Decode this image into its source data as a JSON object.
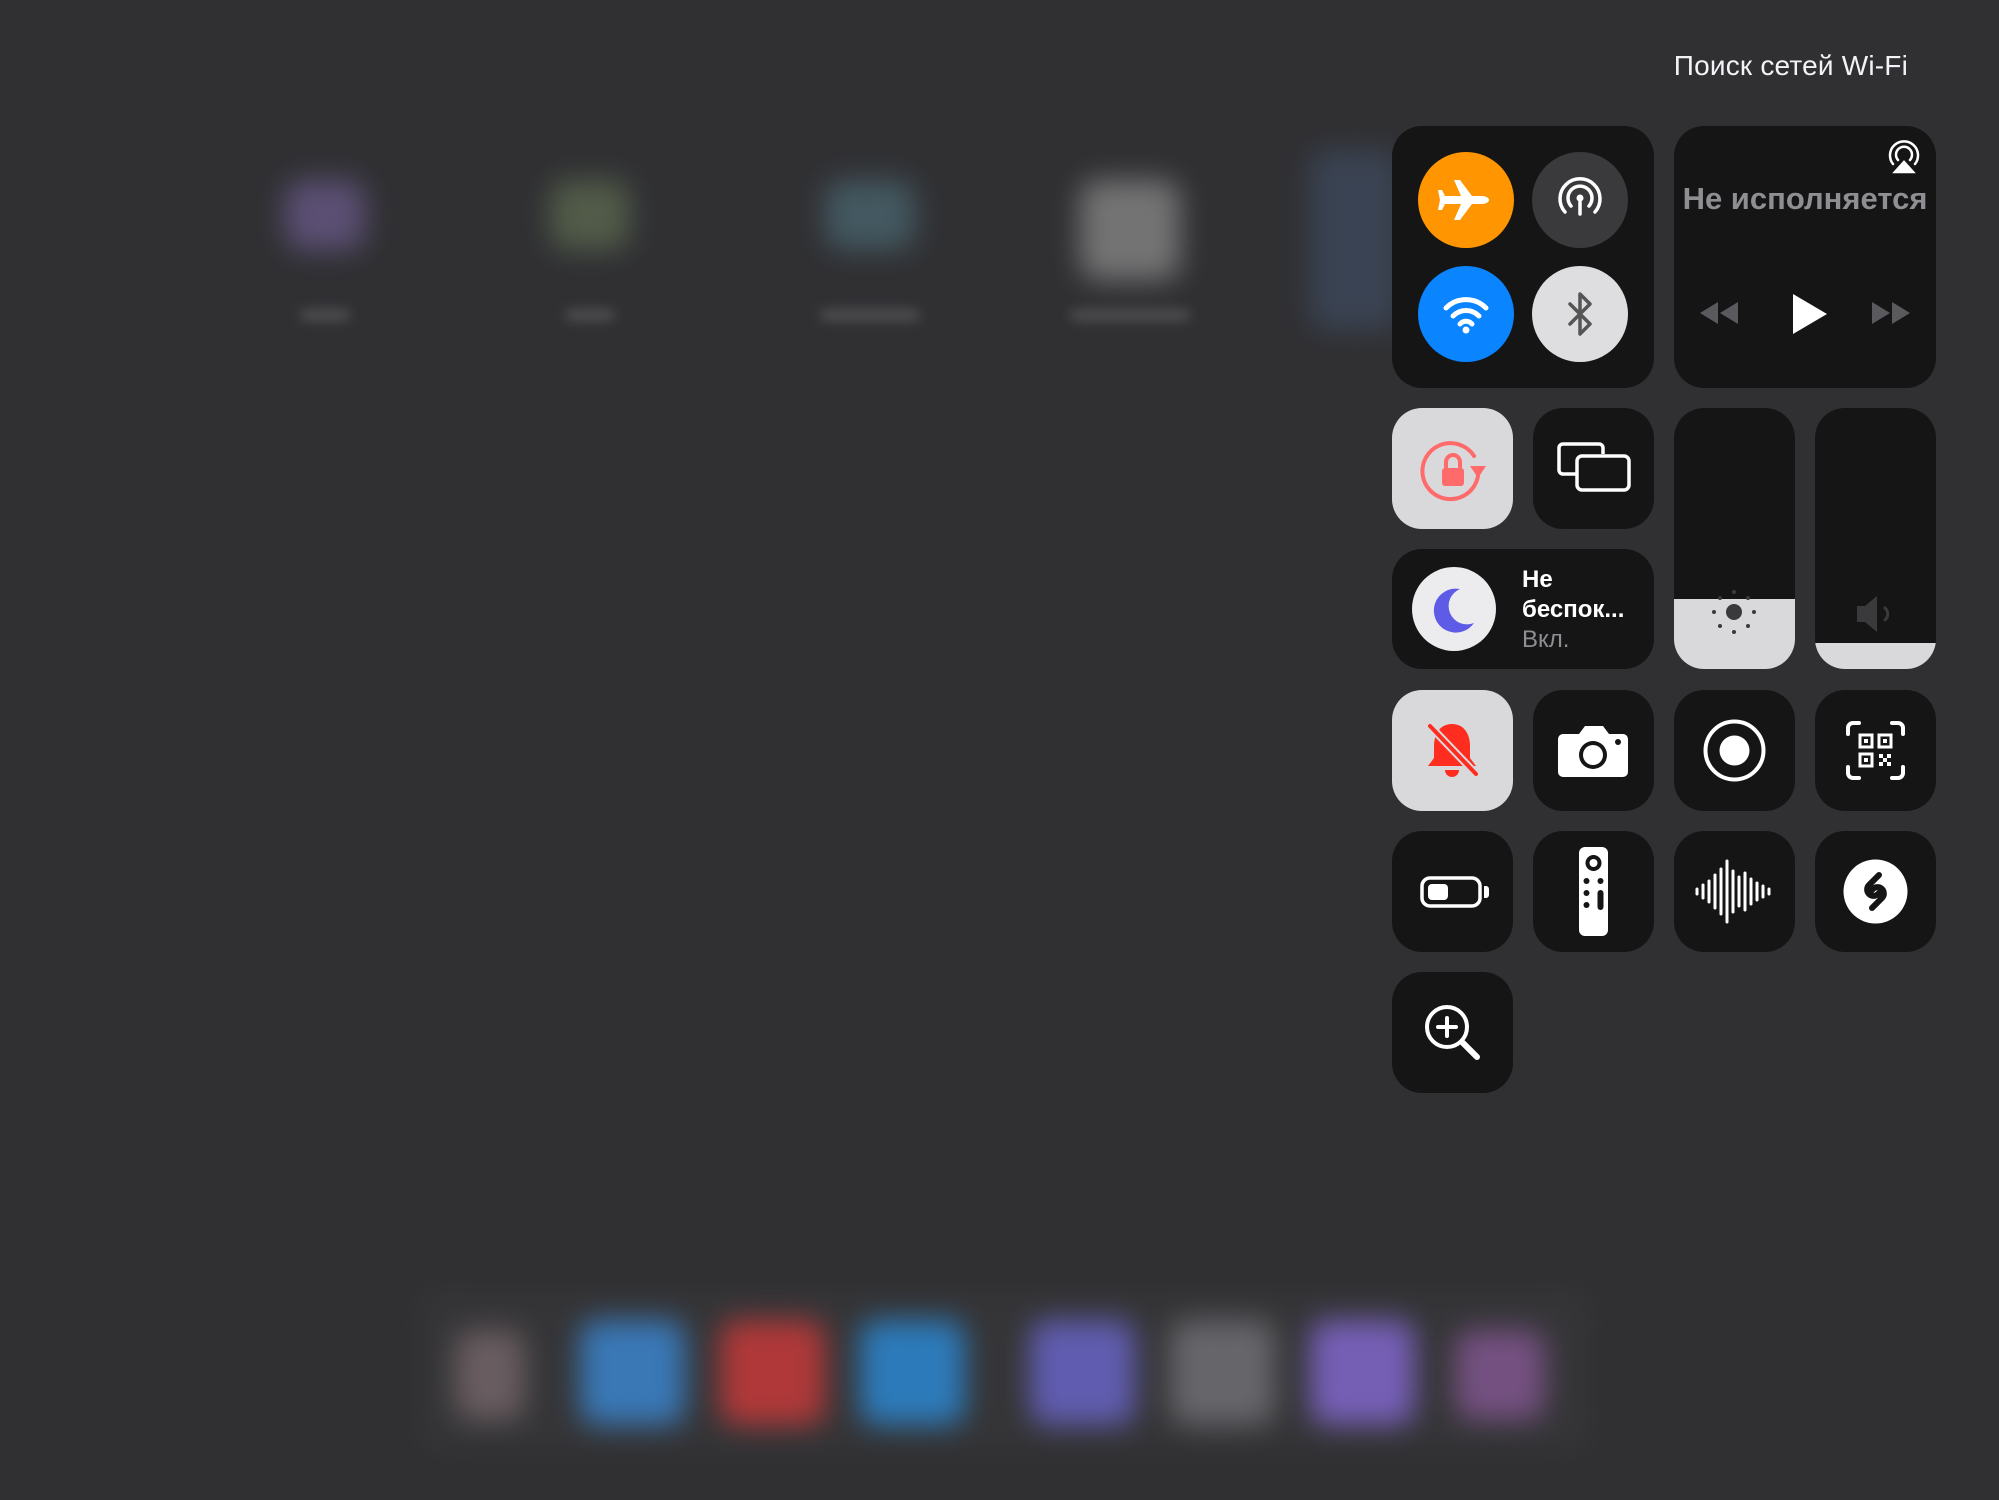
{
  "status_bar": {
    "wifi_search_text": "Поиск сетей Wi-Fi"
  },
  "colors": {
    "background": "#303033",
    "tile_dark": "#151516",
    "tile_light": "#d9d9dc",
    "airplane_active": "#ff9500",
    "wifi_active": "#0a84ff",
    "dnd_moon": "#5e5ce6",
    "silent_bell": "#ff2d20",
    "rotation_lock": "#ff6b6b"
  },
  "connectivity": {
    "airplane_mode": {
      "icon": "airplane-icon",
      "on": true
    },
    "airdrop": {
      "icon": "airdrop-icon",
      "on": false
    },
    "wifi": {
      "icon": "wifi-icon",
      "on": true
    },
    "bluetooth": {
      "icon": "bluetooth-icon",
      "on": false
    }
  },
  "now_playing": {
    "title": "Не исполняется",
    "airplay_icon": "airplay-icon",
    "prev_icon": "backward-icon",
    "play_icon": "play-icon",
    "next_icon": "forward-icon"
  },
  "focus": {
    "title": "Не беспок...",
    "status": "Вкл.",
    "icon": "moon-icon"
  },
  "sliders": {
    "brightness": {
      "icon": "sun-icon",
      "level": 0.27
    },
    "volume": {
      "icon": "speaker-icon",
      "level": 0.1
    }
  },
  "controls": [
    "orientation-lock-icon",
    "screen-mirroring-icon",
    "silent-mode-icon",
    "camera-icon",
    "screen-recording-icon",
    "qr-code-scanner-icon",
    "low-power-mode-icon",
    "apple-tv-remote-icon",
    "voice-memos-icon",
    "shazam-icon",
    "magnifier-icon"
  ]
}
